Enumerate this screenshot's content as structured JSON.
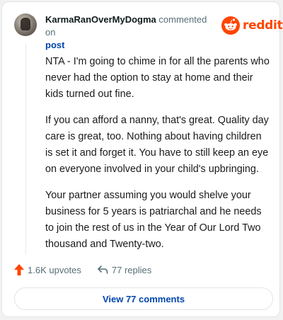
{
  "header": {
    "username": "KarmaRanOverMyDogma",
    "commented_on": "commented on",
    "post_link": "post",
    "brand": "reddit"
  },
  "comment": {
    "paragraphs": [
      "NTA - I'm going to chime in for all the parents who never had the option to stay at home and their kids turned out fine.",
      "If you can afford a nanny, that's great. Quality day care is great, too. Nothing about having children is set it and forget it. You have to still keep an eye on everyone involved in your child's upbringing.",
      "Your partner assuming you would shelve your business for 5 years is patriarchal and he needs to join the rest of us in the Year of Our Lord Two thousand and Twenty-two."
    ]
  },
  "actions": {
    "upvotes": "1.6K upvotes",
    "replies": "77 replies"
  },
  "footer": {
    "view_comments": "View 77 comments"
  },
  "icons": {
    "avatar": "user-avatar",
    "logo": "reddit-snoo-icon",
    "upvote": "upvote-arrow-icon",
    "reply": "reply-arrow-icon"
  },
  "colors": {
    "brand": "#ff4500",
    "link": "#0045ac",
    "text": "#1a1a1b",
    "muted": "#576f76"
  }
}
